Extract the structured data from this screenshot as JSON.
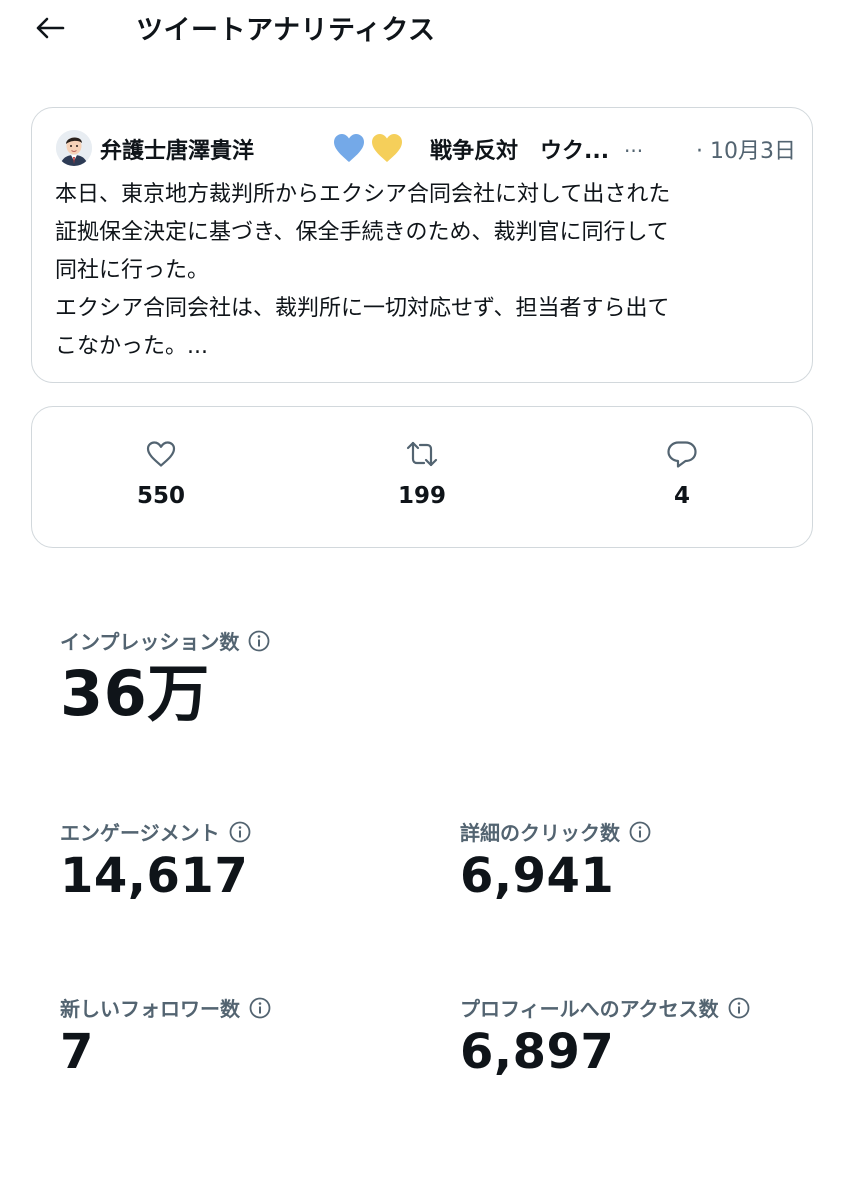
{
  "header": {
    "title": "ツイートアナリティクス"
  },
  "tweet": {
    "author_name": "弁護士唐澤貴洋",
    "slogan": "戦争反対　ウク...",
    "more": "...",
    "date": "· 10月3日",
    "body_lines": [
      "本日、東京地方裁判所からエクシア合同会社に対して出された",
      "証拠保全決定に基づき、保全手続きのため、裁判官に同行して",
      "同社に行った。",
      "エクシア合同会社は、裁判所に一切対応せず、担当者すら出て",
      "こなかった。..."
    ],
    "heart_colors": [
      "#74a9e8",
      "#f5cf5a"
    ]
  },
  "engagement": {
    "likes": "550",
    "retweets": "199",
    "replies": "4"
  },
  "metrics": {
    "impressions": {
      "label": "インプレッション数",
      "value": "36万"
    },
    "engagements": {
      "label": "エンゲージメント",
      "value": "14,617"
    },
    "detail_clicks": {
      "label": "詳細のクリック数",
      "value": "6,941"
    },
    "new_followers": {
      "label": "新しいフォロワー数",
      "value": "7"
    },
    "profile_visits": {
      "label": "プロフィールへのアクセス数",
      "value": "6,897"
    }
  },
  "colors": {
    "text": "#0f1419",
    "secondary": "#536471",
    "border": "#d2d8dc"
  }
}
